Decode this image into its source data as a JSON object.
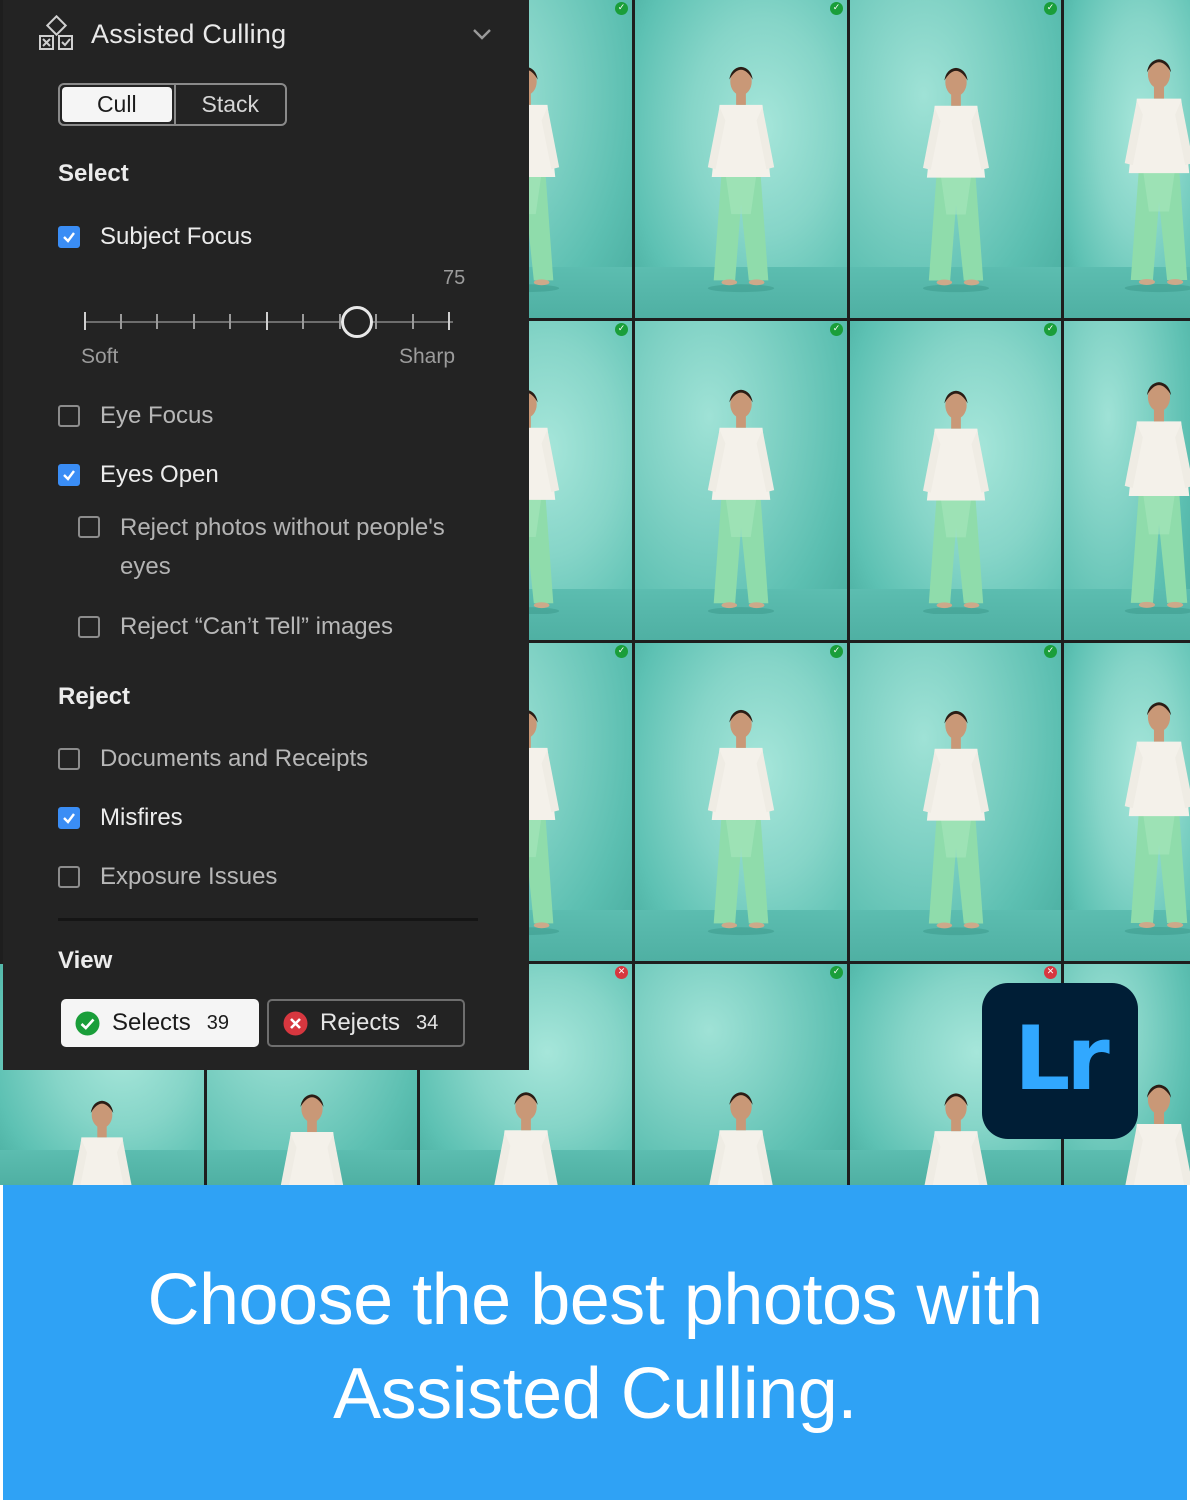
{
  "panel": {
    "title": "Assisted Culling",
    "mode_tabs": [
      "Cull",
      "Stack"
    ],
    "active_tab": "Cull",
    "select_section": {
      "heading": "Select",
      "subject_focus": {
        "label": "Subject Focus",
        "checked": true
      },
      "focus_slider": {
        "value": "75",
        "value_numeric": 75,
        "min_label": "Soft",
        "max_label": "Sharp"
      },
      "eye_focus": {
        "label": "Eye Focus",
        "checked": false
      },
      "eyes_open": {
        "label": "Eyes Open",
        "checked": true
      },
      "reject_no_eyes": {
        "label_line1": "Reject photos without people's",
        "label_line2": "eyes",
        "checked": false
      },
      "reject_cant_tell": {
        "label": "Reject “Can’t Tell” images",
        "checked": false
      }
    },
    "reject_section": {
      "heading": "Reject",
      "documents": {
        "label": "Documents and Receipts",
        "checked": false
      },
      "misfires": {
        "label": "Misfires",
        "checked": true
      },
      "exposure": {
        "label": "Exposure Issues",
        "checked": false
      }
    },
    "view_section": {
      "heading": "View",
      "selects": {
        "label": "Selects",
        "count": "39"
      },
      "rejects": {
        "label": "Rejects",
        "count": "34"
      }
    }
  },
  "logo": {
    "text": "Lr",
    "bg": "#001e36",
    "fg": "#31a8ff"
  },
  "banner": {
    "line1": "Choose the best photos with",
    "line2": "Assisted Culling.",
    "bg": "#2fa2f5"
  },
  "colors": {
    "panel_bg": "#232323",
    "checkbox_on": "#3a8df5",
    "select_badge": "#1a9e3a",
    "reject_badge": "#d7373f"
  }
}
